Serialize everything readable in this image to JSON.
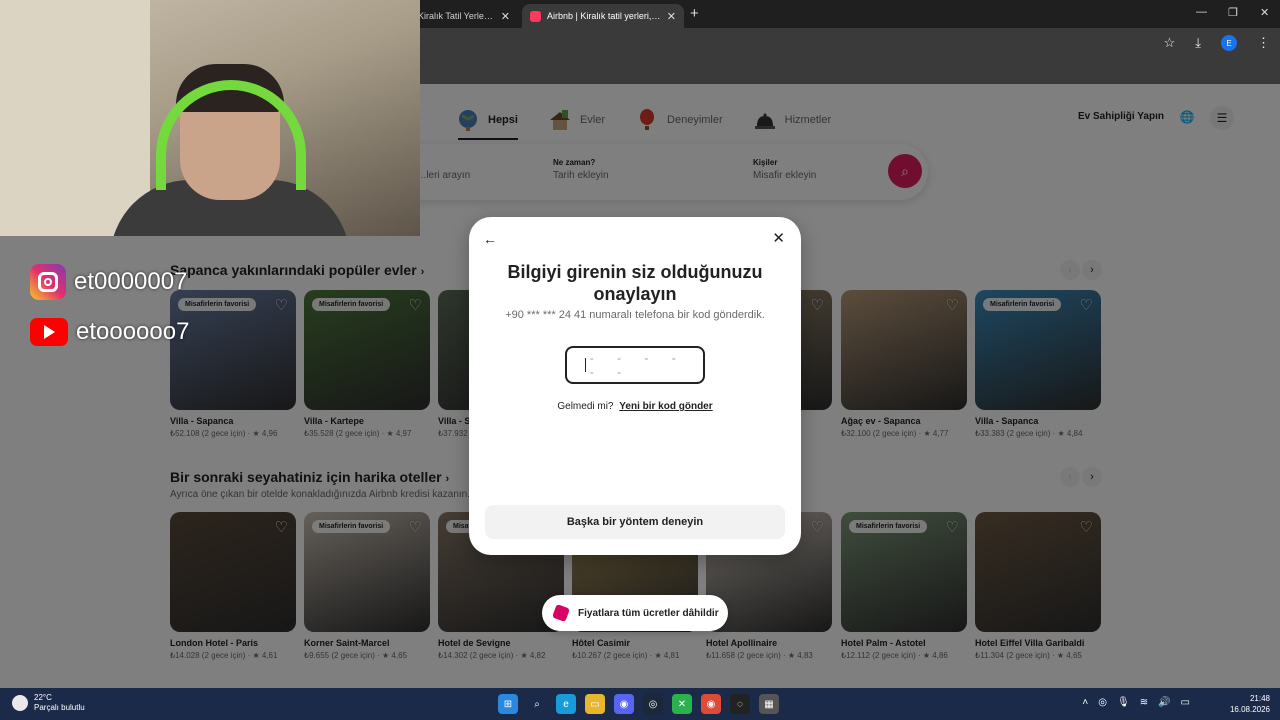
{
  "browser": {
    "tabs": [
      {
        "label": "Kiralık Tatil Yerleri, Kulü",
        "active": false
      },
      {
        "label": "Airbnb | Kiralık tatil yerleri, kulü",
        "active": true
      }
    ],
    "new_tab": "+",
    "window_controls": [
      "—",
      "❐",
      "✕"
    ]
  },
  "nav": {
    "items": [
      {
        "label": "Hepsi",
        "icon": "globe-icon",
        "active": true
      },
      {
        "label": "Evler",
        "icon": "house-icon",
        "active": false
      },
      {
        "label": "Deneyimler",
        "icon": "balloon-icon",
        "active": false
      },
      {
        "label": "Hizmetler",
        "icon": "bell-icon",
        "active": false
      }
    ],
    "host_label": "Ev Sahipliği Yapın"
  },
  "search": {
    "where_placeholder": "...leri arayın",
    "when_title": "Ne zaman?",
    "when_placeholder": "Tarih ekleyin",
    "who_title": "Kişiler",
    "who_placeholder": "Misafir ekleyin"
  },
  "sections": [
    {
      "title": "Sapanca yakınlarındaki popüler evler",
      "subtitle": "",
      "cards": [
        {
          "name": "Villa - Sapanca",
          "info": "₺52.108 (2 gece için) · ★ 4,96",
          "badge": "Misafirlerin favorisi",
          "color": "#6b7fa6"
        },
        {
          "name": "Villa - Kartepe",
          "info": "₺35.528 (2 gece için) · ★ 4,97",
          "badge": "Misafirlerin favorisi",
          "color": "#4f7a3d"
        },
        {
          "name": "Villa - S",
          "info": "₺37.932",
          "badge": "",
          "color": "#5d6d58"
        },
        {
          "name": "",
          "info": "5,0",
          "badge": "",
          "color": "#9a8a70"
        },
        {
          "name": "Ağaç ev - Sapanca",
          "info": "₺32.100 (2 gece için) · ★ 4,77",
          "badge": "",
          "color": "#b89b7a"
        },
        {
          "name": "Villa - Sapanca",
          "info": "₺33.383 (2 gece için) · ★ 4,84",
          "badge": "Misafirlerin favorisi",
          "color": "#3c8fc0"
        }
      ]
    },
    {
      "title": "Bir sonraki seyahatiniz için harika oteller",
      "subtitle": "Ayrıca öne çıkan bir otelde konakladığınızda Airbnb kredisi kazanın.",
      "cards": [
        {
          "name": "London Hotel - Paris",
          "info": "₺14.028 (2 gece için) · ★ 4,61",
          "badge": "",
          "color": "#5a4a3a"
        },
        {
          "name": "Korner Saint-Marcel",
          "info": "₺9.655 (2 gece için) · ★ 4,65",
          "badge": "Misafirlerin favorisi",
          "color": "#c9bfb3"
        },
        {
          "name": "Hotel de Sevigne",
          "info": "₺14.302 (2 gece için) · ★ 4,82",
          "badge": "Misafirlerin favorisi",
          "color": "#8c7b6a"
        },
        {
          "name": "Hôtel Casimir",
          "info": "₺10.267 (2 gece için) · ★ 4,81",
          "badge": "",
          "color": "#b79c5e"
        },
        {
          "name": "Hotel Apollinaire",
          "info": "₺11.658 (2 gece için) · ★ 4,83",
          "badge": "",
          "color": "#d8cfc4"
        },
        {
          "name": "Hotel Palm - Astotel",
          "info": "₺12.112 (2 gece için) · ★ 4,86",
          "badge": "Misafirlerin favorisi",
          "color": "#7f9a7a"
        },
        {
          "name": "Hotel Eiffel Villa Garibaldi",
          "info": "₺11.304 (2 gece için) · ★ 4,65",
          "badge": "",
          "color": "#6e5a44"
        }
      ]
    }
  ],
  "toast": "Fiyatlara tüm ücretler dâhildir",
  "modal": {
    "title": "Bilgiyi girenin siz olduğunuzu onaylayın",
    "subtitle": "+90 *** *** 24 41 numaralı telefona bir kod gönderdik.",
    "code_placeholder": "- - - - - -",
    "resend_prefix": "Gelmedi mi?",
    "resend_link": "Yeni bir kod gönder",
    "other_method": "Başka bir yöntem deneyin"
  },
  "overlay_social": {
    "instagram": "et0000007",
    "youtube": "etoooooo7"
  },
  "taskbar": {
    "temp": "22°C",
    "weather": "Parçalı bulutlu",
    "time": "21:48",
    "date": "16.08.2026"
  },
  "colors": {
    "brand": "#ff385c",
    "search_button": "#e31c5f",
    "taskbar": "#1c2a4a"
  }
}
